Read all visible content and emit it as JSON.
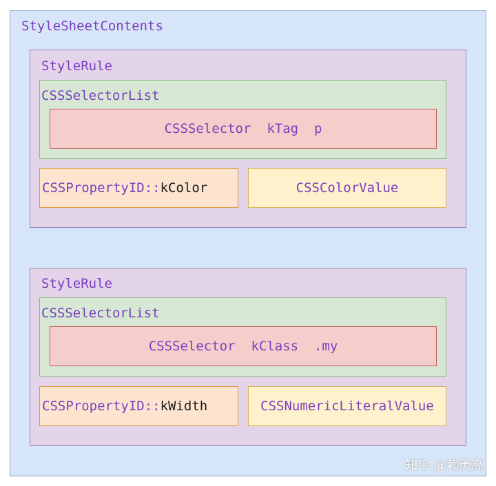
{
  "sheet": {
    "label": "StyleSheetContents"
  },
  "rules": [
    {
      "label": "StyleRule",
      "selector_list_label": "CSSSelectorList",
      "selector": {
        "name": "CSSSelector",
        "kind": "kTag",
        "value": "p"
      },
      "property": {
        "prefix": "CSSPropertyID::",
        "id": "kColor"
      },
      "value_type": "CSSColorValue"
    },
    {
      "label": "StyleRule",
      "selector_list_label": "CSSSelectorList",
      "selector": {
        "name": "CSSSelector",
        "kind": "kClass",
        "value": ".my"
      },
      "property": {
        "prefix": "CSSPropertyID::",
        "id": "kWidth"
      },
      "value_type": "CSSNumericLiteralValue"
    }
  ],
  "watermark": "知乎 @赖勇高",
  "colors": {
    "sheet_bg": "#d7e5f8",
    "rule_bg": "#e3d4ea",
    "selector_list_bg": "#d6e7d3",
    "selector_bg": "#f5cdcb",
    "property_bg": "#fde4cf",
    "value_bg": "#fff1cc",
    "label_text": "#7b3fbf"
  }
}
